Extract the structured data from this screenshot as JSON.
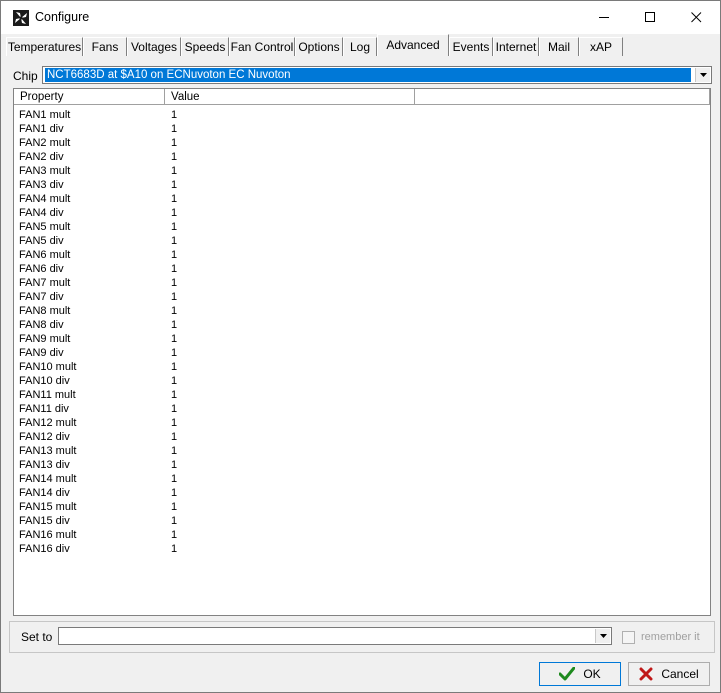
{
  "window": {
    "title": "Configure"
  },
  "tabs": [
    {
      "label": "Temperatures"
    },
    {
      "label": "Fans"
    },
    {
      "label": "Voltages"
    },
    {
      "label": "Speeds"
    },
    {
      "label": "Fan Control"
    },
    {
      "label": "Options"
    },
    {
      "label": "Log"
    },
    {
      "label": "Advanced"
    },
    {
      "label": "Events"
    },
    {
      "label": "Internet"
    },
    {
      "label": "Mail"
    },
    {
      "label": "xAP"
    }
  ],
  "active_tab": "Advanced",
  "chip": {
    "label": "Chip",
    "value": "NCT6683D at $A10 on ECNuvoton EC Nuvoton"
  },
  "table": {
    "headers": {
      "property": "Property",
      "value": "Value"
    },
    "rows": [
      {
        "property": "FAN1 mult",
        "value": "1"
      },
      {
        "property": "FAN1 div",
        "value": "1"
      },
      {
        "property": "FAN2 mult",
        "value": "1"
      },
      {
        "property": "FAN2 div",
        "value": "1"
      },
      {
        "property": "FAN3 mult",
        "value": "1"
      },
      {
        "property": "FAN3 div",
        "value": "1"
      },
      {
        "property": "FAN4 mult",
        "value": "1"
      },
      {
        "property": "FAN4 div",
        "value": "1"
      },
      {
        "property": "FAN5 mult",
        "value": "1"
      },
      {
        "property": "FAN5 div",
        "value": "1"
      },
      {
        "property": "FAN6 mult",
        "value": "1"
      },
      {
        "property": "FAN6 div",
        "value": "1"
      },
      {
        "property": "FAN7 mult",
        "value": "1"
      },
      {
        "property": "FAN7 div",
        "value": "1"
      },
      {
        "property": "FAN8 mult",
        "value": "1"
      },
      {
        "property": "FAN8 div",
        "value": "1"
      },
      {
        "property": "FAN9 mult",
        "value": "1"
      },
      {
        "property": "FAN9 div",
        "value": "1"
      },
      {
        "property": "FAN10 mult",
        "value": "1"
      },
      {
        "property": "FAN10 div",
        "value": "1"
      },
      {
        "property": "FAN11 mult",
        "value": "1"
      },
      {
        "property": "FAN11 div",
        "value": "1"
      },
      {
        "property": "FAN12 mult",
        "value": "1"
      },
      {
        "property": "FAN12 div",
        "value": "1"
      },
      {
        "property": "FAN13 mult",
        "value": "1"
      },
      {
        "property": "FAN13 div",
        "value": "1"
      },
      {
        "property": "FAN14 mult",
        "value": "1"
      },
      {
        "property": "FAN14 div",
        "value": "1"
      },
      {
        "property": "FAN15 mult",
        "value": "1"
      },
      {
        "property": "FAN15 div",
        "value": "1"
      },
      {
        "property": "FAN16 mult",
        "value": "1"
      },
      {
        "property": "FAN16 div",
        "value": "1"
      }
    ]
  },
  "set_to": {
    "label": "Set to",
    "value": ""
  },
  "remember": {
    "label": "remember it",
    "checked": false
  },
  "buttons": {
    "ok": "OK",
    "cancel": "Cancel"
  },
  "icons": {
    "app": "fan-icon",
    "minimize": "minimize-icon",
    "maximize": "maximize-icon",
    "close": "close-icon",
    "dropdown": "chevron-down-icon",
    "ok": "checkmark-icon",
    "cancel": "x-mark-icon"
  },
  "colors": {
    "selection": "#0078d7",
    "ok_check": "#1e8a1e",
    "cancel_x": "#c01818"
  }
}
